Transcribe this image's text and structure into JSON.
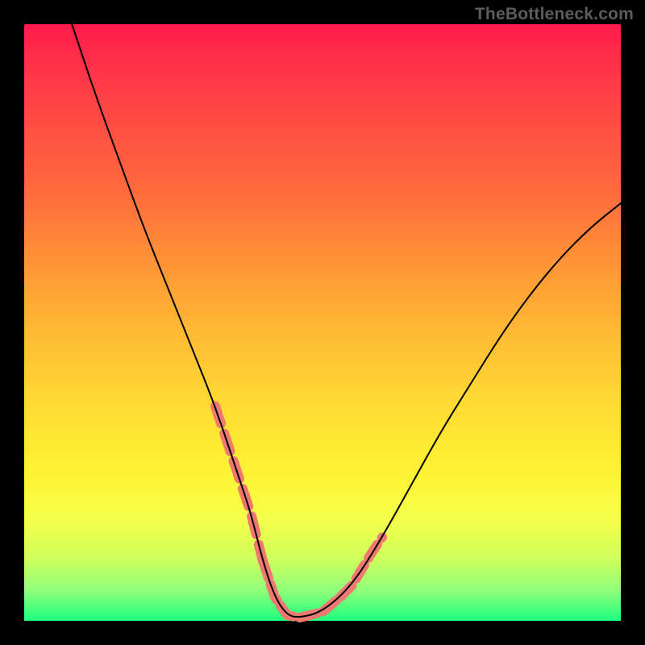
{
  "attribution": "TheBottleneck.com",
  "chart_data": {
    "type": "line",
    "title": "",
    "xlabel": "",
    "ylabel": "",
    "xlim": [
      0,
      100
    ],
    "ylim": [
      0,
      100
    ],
    "grid": false,
    "legend": null,
    "background_gradient": {
      "direction": "vertical",
      "stops": [
        {
          "pct": 0,
          "color": "#ff1a4c"
        },
        {
          "pct": 10,
          "color": "#ff3b47"
        },
        {
          "pct": 28,
          "color": "#ff6a3c"
        },
        {
          "pct": 45,
          "color": "#ffa534"
        },
        {
          "pct": 62,
          "color": "#ffd733"
        },
        {
          "pct": 75,
          "color": "#fff233"
        },
        {
          "pct": 83,
          "color": "#f6ff4a"
        },
        {
          "pct": 90,
          "color": "#cbff5c"
        },
        {
          "pct": 95,
          "color": "#8dff7a"
        },
        {
          "pct": 100,
          "color": "#1cff7e"
        }
      ]
    },
    "series": [
      {
        "name": "bottleneck-curve",
        "type": "line",
        "stroke": "#000000",
        "stroke_width": 2,
        "x": [
          8,
          12,
          16,
          20,
          24,
          28,
          32,
          36,
          38,
          40,
          42,
          44,
          46,
          50,
          55,
          60,
          65,
          70,
          75,
          80,
          85,
          90,
          95,
          100
        ],
        "y": [
          100,
          88,
          77,
          66,
          56,
          46,
          36,
          24,
          18,
          10,
          4,
          1,
          0.5,
          1.5,
          6,
          14,
          23,
          32,
          40,
          48,
          55,
          61,
          66,
          70
        ]
      },
      {
        "name": "highlight-left",
        "type": "line",
        "stroke": "#ef7871",
        "stroke_width": 12,
        "dash": "23 13",
        "x": [
          32,
          36,
          38,
          40
        ],
        "y": [
          36,
          24,
          18,
          10
        ]
      },
      {
        "name": "highlight-bottom",
        "type": "line",
        "stroke": "#ef7871",
        "stroke_width": 12,
        "dash": "22 8",
        "x": [
          40,
          42,
          44,
          46,
          50,
          53
        ],
        "y": [
          10,
          4,
          1,
          0.5,
          1.5,
          4
        ]
      },
      {
        "name": "highlight-right",
        "type": "line",
        "stroke": "#ef7871",
        "stroke_width": 12,
        "dash": "20 10",
        "x": [
          53,
          55,
          58,
          60
        ],
        "y": [
          4,
          6,
          11,
          14
        ]
      }
    ]
  }
}
